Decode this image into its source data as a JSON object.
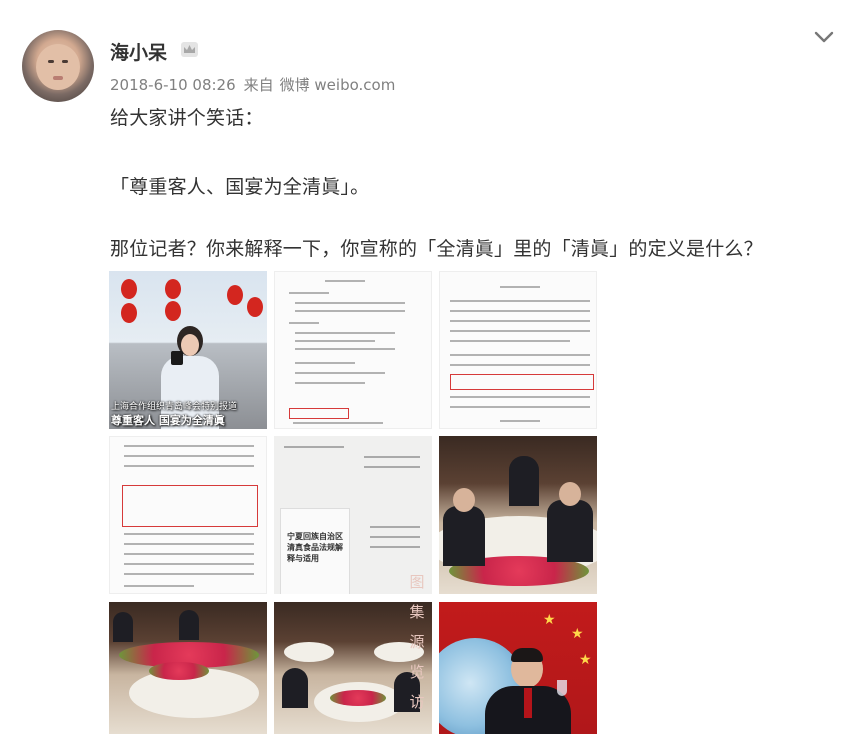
{
  "post": {
    "author": "海小呆",
    "timestamp": "2018-6-10 08:26",
    "source_prefix": "来自",
    "source": "微博 weibo.com",
    "icons": {
      "badge": "crown-icon",
      "menu": "chevron-down-icon"
    },
    "text_lines": [
      "给大家讲个笑话：",
      "「尊重客人、国宴为全清眞」。",
      "那位记者？你来解释一下，你宣称的「全清眞」里的「清眞」的定义是什么？"
    ]
  },
  "images": {
    "count": 9,
    "news_caption_top": "上海合作组织青岛峰会特别报道",
    "news_caption_bottom": "尊重客人 国宴为全清眞",
    "book_title": "宁夏回族自治区清真食品法规解释与适用",
    "watermark": "图集源览访"
  }
}
